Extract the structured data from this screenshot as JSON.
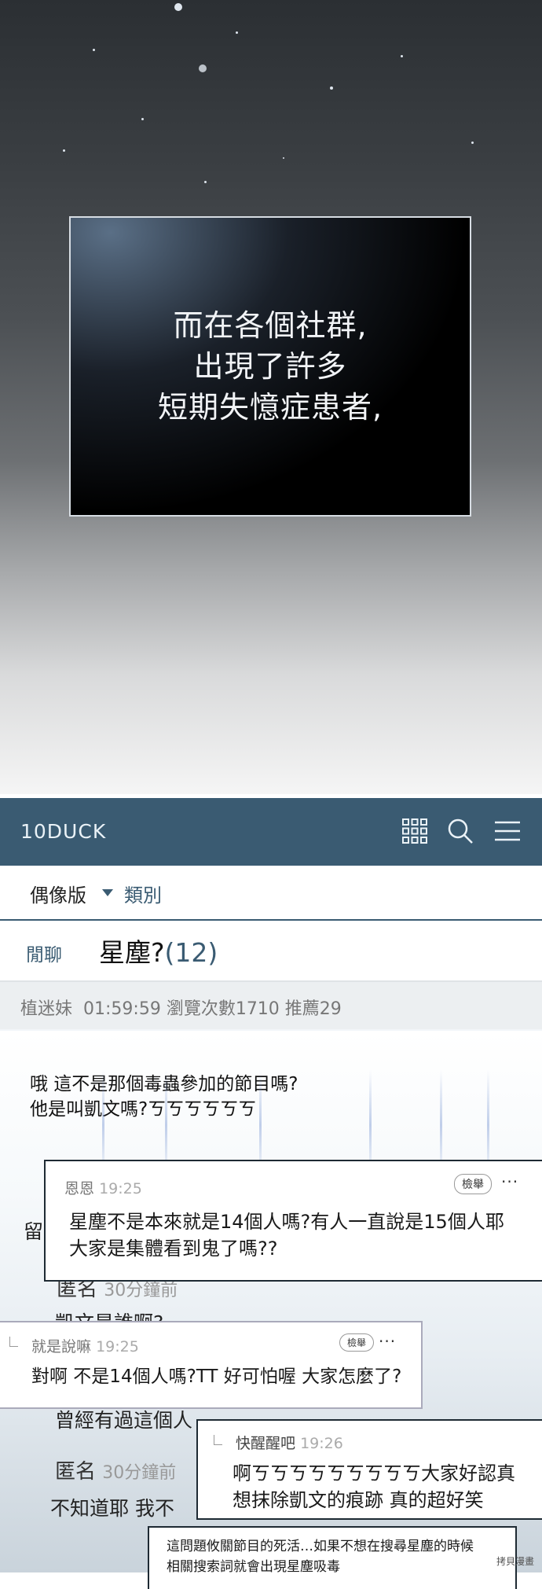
{
  "comic": {
    "narration": [
      "而在各個社群,",
      "出現了許多",
      "短期失憶症患者,"
    ]
  },
  "forum": {
    "brand": "10DUCK",
    "board": "偶像版",
    "category": "類別",
    "post": {
      "tag": "閒聊",
      "title": "星塵?",
      "count": "(12)",
      "author": "植迷妹",
      "meta": "01:59:59 瀏覽次數1710 推薦29",
      "lines": [
        "哦 這不是那個毒蟲參加的節目嗎?",
        "他是叫凱文嗎?ㄎㄎㄎㄎㄎㄎ"
      ]
    },
    "background": {
      "leave": "留",
      "anon1_name": "匿名",
      "anon1_time": "30分鐘前",
      "anon1_text": "凱文是誰啊?",
      "line2": "曾經有過這個人",
      "anon2_name": "匿名",
      "anon2_time": "30分鐘前",
      "anon2_text": "不知道耶 我不"
    },
    "comments": [
      {
        "user": "恩恩",
        "time": "19:25",
        "report": "檢舉",
        "more": "···",
        "lines": [
          "星塵不是本來就是14個人嗎?有人一直說是15個人耶",
          "大家是集體看到鬼了嗎??"
        ]
      },
      {
        "user": "就是說嘛",
        "time": "19:25",
        "report": "檢舉",
        "more": "···",
        "lines": [
          "對啊 不是14個人嗎?TT 好可怕喔 大家怎麼了?"
        ]
      },
      {
        "user": "快醒醒吧",
        "time": "19:26",
        "lines": [
          "啊ㄎㄎㄎㄎㄎㄎㄎㄎㄎ大家好認真",
          "想抹除凱文的痕跡 真的超好笑"
        ]
      },
      {
        "lines": [
          "這問題攸關節目的死活…如果不想在搜尋星塵的時候",
          "相關搜索詞就會出現星塵吸毒"
        ]
      }
    ]
  },
  "watermark": "拷貝漫畫"
}
